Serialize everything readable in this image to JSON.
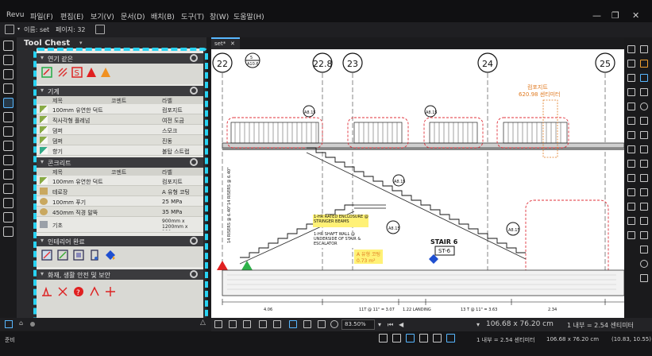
{
  "menu": {
    "app": "Revu",
    "items": [
      "파일(F)",
      "편집(E)",
      "보기(V)",
      "문서(D)",
      "배치(B)",
      "도구(T)",
      "창(W)",
      "도움말(H)"
    ]
  },
  "propbar": {
    "name_label": "이름: set",
    "pages_label": "페이지: 32"
  },
  "tool_chest": {
    "title": "Tool Chest",
    "sections": [
      {
        "title": "연기 같은"
      },
      {
        "title": "기계",
        "columns": [
          "제목",
          "코멘트",
          "라벨"
        ],
        "rows": [
          {
            "title": "100mm 유연한 덕트",
            "comment": "",
            "label": "컴포지트"
          },
          {
            "title": "직사각형 플레넘",
            "comment": "",
            "label": "여전 도금"
          },
          {
            "title": "댐퍼",
            "comment": "",
            "label": "스모크"
          },
          {
            "title": "댐퍼",
            "comment": "",
            "label": "진동"
          },
          {
            "title": "향기",
            "comment": "",
            "label": "볼탑 스트랩"
          }
        ]
      },
      {
        "title": "콘크리트",
        "columns": [
          "제목",
          "코멘트",
          "라벨"
        ],
        "rows": [
          {
            "title": "100mm 유연한 덕트",
            "comment": "",
            "label": "컴포지트"
          },
          {
            "title": "테로장",
            "comment": "",
            "label": "A 유형 코팅"
          },
          {
            "title": "100mm 푸기",
            "comment": "",
            "label": "25 MPa"
          },
          {
            "title": "450mm 직경 말뚝",
            "comment": "",
            "label": "35 MPa"
          },
          {
            "title": "기초",
            "comment": "",
            "label": "900mm x 1200mm x 180..."
          }
        ]
      },
      {
        "title": "인테리어 완료"
      },
      {
        "title": "화재, 생활 안전 및 보안"
      }
    ]
  },
  "document": {
    "tab": "set*",
    "grid_labels": [
      "22",
      "22.8",
      "23",
      "24",
      "25"
    ],
    "annotations": {
      "hr_enclosure": "1-HR RATED ENCLOSURE @ STRINGER BEAMS",
      "hr_shaft": "1-HR SHAFT WALL @ UNDERSIDE OF STAIR & ESCALATOR",
      "coating": "A 유형 코팅",
      "area": "0.73 m²",
      "stair": "STAIR 6",
      "stair_tag": "ST-6",
      "composite": "컴포지트",
      "composite_dims": "620.98 센티미터",
      "riser1": "14 RISERS @ 6.40\"",
      "riser2": "14 RISERS @ 6.40\"",
      "tread1": "11T @ 11\" = 3.07",
      "landing": "1.22 LANDING",
      "tread2": "13 T @ 11\" = 3.63",
      "dim_left": "4.06",
      "dim_right": "2.34",
      "detail_a": "A8.15",
      "detail_b": "A8.15",
      "detail_c": "A8.15",
      "detail_d": "A8.15",
      "detail_e": "A8.15",
      "section_marker": "A10.6",
      "section_num": "5"
    }
  },
  "doctool": {
    "zoom": "83.50%",
    "dims": "106.68 x 76.20 cm",
    "scale": "1 내부 = 2.54 센티미터"
  },
  "status": {
    "left": "준비",
    "scale": "1 내부 = 2.54 센티미터",
    "size": "106.68 x 76.20 cm",
    "coords": "(10.83, 10.55)"
  }
}
